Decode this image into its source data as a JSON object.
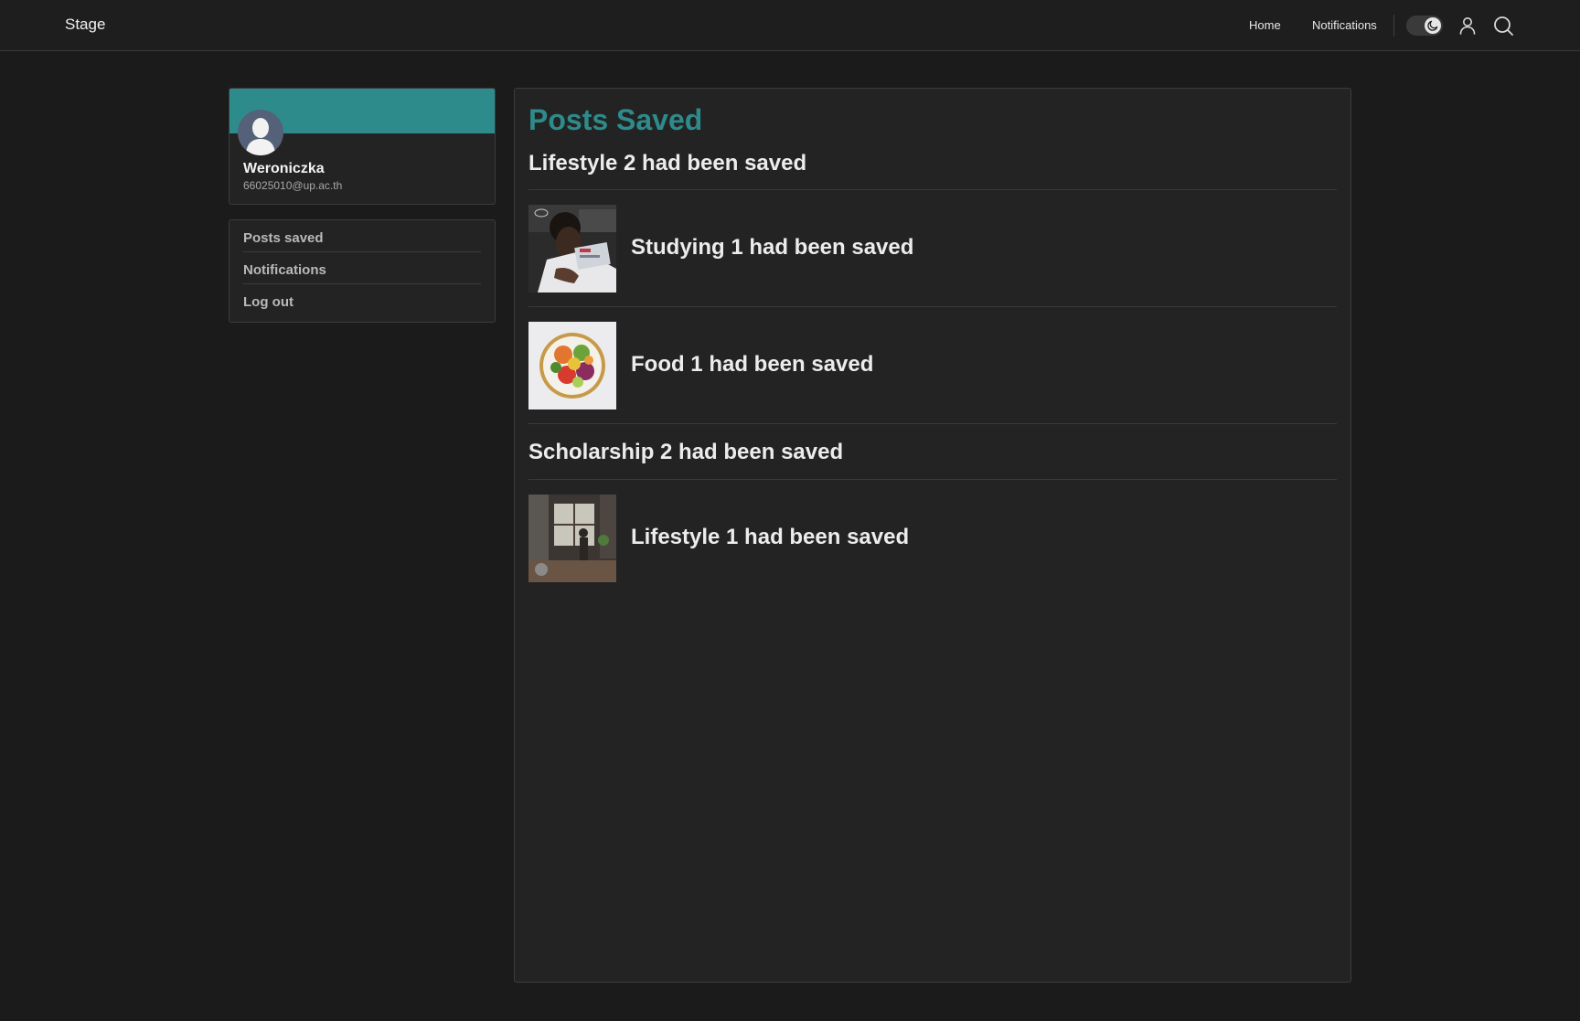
{
  "app": {
    "brand": "Stage"
  },
  "nav": {
    "home": "Home",
    "notifications": "Notifications",
    "theme_toggle_icon": "moon-icon",
    "profile_icon": "user-icon",
    "search_icon": "search-icon"
  },
  "profile": {
    "name": "Weroniczka",
    "email": "66025010@up.ac.th",
    "banner_color": "#2e8b8b",
    "avatar_icon": "avatar-placeholder-icon"
  },
  "sidebar": {
    "items": [
      {
        "label": "Posts saved"
      },
      {
        "label": "Notifications"
      },
      {
        "label": "Log out"
      }
    ]
  },
  "main": {
    "title": "Posts Saved",
    "title_color": "#2e8b8b",
    "saved": [
      {
        "text": "Lifestyle 2 had been saved",
        "has_image": false
      },
      {
        "text": "Studying 1 had been saved",
        "has_image": true,
        "image": "studying-photo"
      },
      {
        "text": "Food 1 had been saved",
        "has_image": true,
        "image": "salad-bowl-photo"
      },
      {
        "text": "Scholarship 2 had been saved",
        "has_image": false
      },
      {
        "text": "Lifestyle 1 had been saved",
        "has_image": true,
        "image": "kitchen-photo"
      }
    ]
  }
}
